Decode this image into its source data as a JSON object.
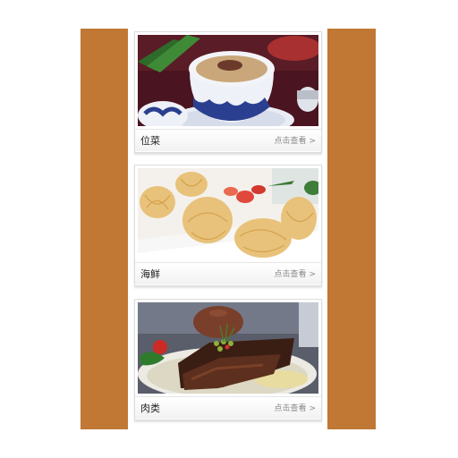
{
  "cards": [
    {
      "title": "位菜",
      "more": "点击查看",
      "chevron": ">"
    },
    {
      "title": "海鲜",
      "more": "点击查看",
      "chevron": ">"
    },
    {
      "title": "肉类",
      "more": "点击查看",
      "chevron": ">"
    }
  ],
  "colors": {
    "side_band": "#c07834",
    "card_bar": "#f2f2f2"
  }
}
